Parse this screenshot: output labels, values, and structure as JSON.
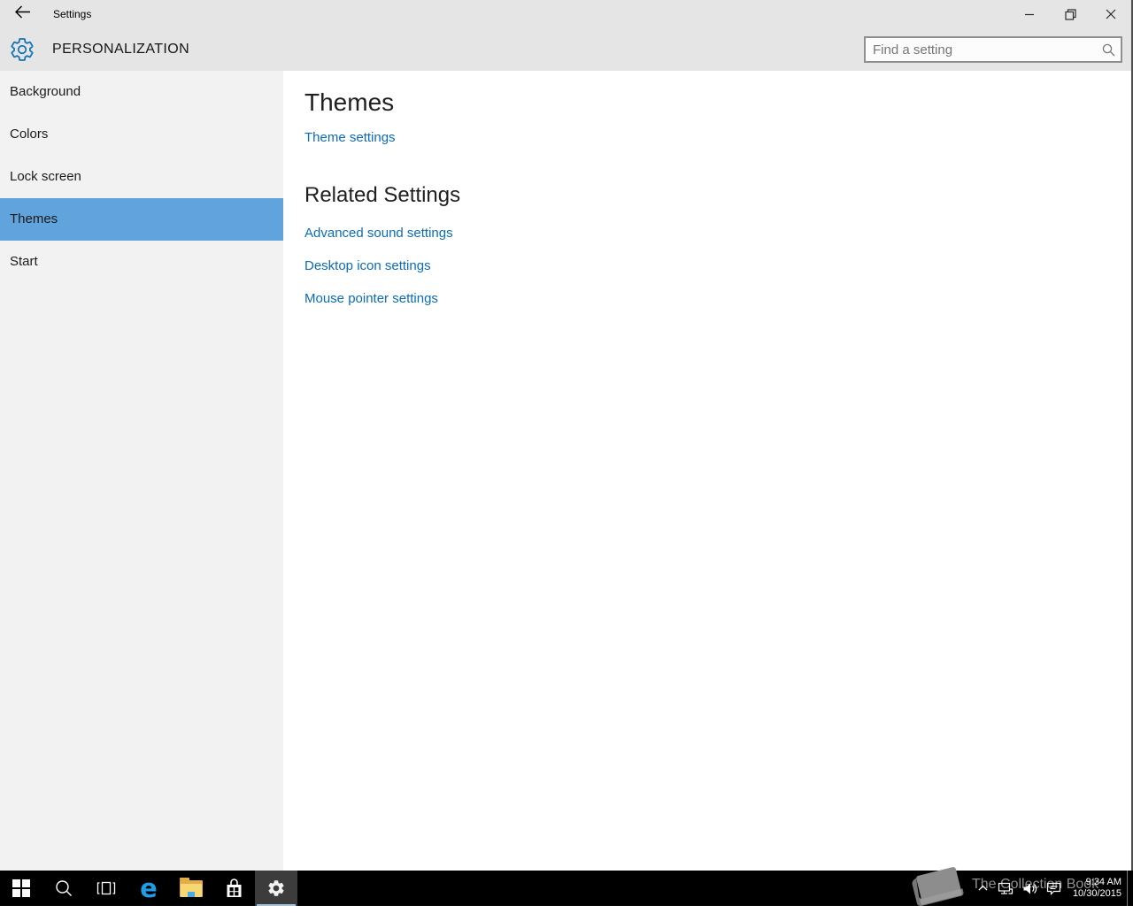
{
  "colors": {
    "accent_selected_blue": "#61a3dc",
    "link_blue": "#0b6cb7",
    "gear_blue": "#1173b8",
    "chrome_gray": "#e5e5e5",
    "sidebar_gray": "#f2f2f2",
    "taskbar_black": "#000000",
    "active_taskbar_button": "#3c3c3c"
  },
  "window": {
    "title": "Settings",
    "controls": [
      "minimize",
      "restore",
      "close"
    ]
  },
  "header": {
    "page_title": "PERSONALIZATION",
    "search": {
      "placeholder": "Find a setting",
      "icon": "search-icon"
    }
  },
  "sidebar": {
    "items": [
      {
        "label": "Background",
        "selected": false
      },
      {
        "label": "Colors",
        "selected": false
      },
      {
        "label": "Lock screen",
        "selected": false
      },
      {
        "label": "Themes",
        "selected": true
      },
      {
        "label": "Start",
        "selected": false
      }
    ]
  },
  "main": {
    "sections": [
      {
        "title": "Themes",
        "links": [
          {
            "label": "Theme settings"
          }
        ]
      },
      {
        "title": "Related Settings",
        "links": [
          {
            "label": "Advanced sound settings"
          },
          {
            "label": "Desktop icon settings"
          },
          {
            "label": "Mouse pointer settings"
          }
        ]
      }
    ]
  },
  "taskbar": {
    "buttons": [
      {
        "name": "start",
        "icon": "windows-logo-icon"
      },
      {
        "name": "search",
        "icon": "search-icon"
      },
      {
        "name": "task-view",
        "icon": "task-view-icon"
      },
      {
        "name": "edge",
        "icon": "edge-icon",
        "glyph": "e"
      },
      {
        "name": "file-explorer",
        "icon": "folder-icon"
      },
      {
        "name": "store",
        "icon": "store-bag-icon"
      },
      {
        "name": "settings",
        "icon": "gear-icon",
        "active": true
      }
    ],
    "watermark": {
      "text": "The Collection Book",
      "icon": "book-icon"
    },
    "tray": {
      "icons": [
        "chevron-up-icon",
        "network-icon",
        "volume-icon",
        "action-center-icon"
      ],
      "clock": {
        "time": "9:34 AM",
        "date": "10/30/2015"
      }
    }
  }
}
